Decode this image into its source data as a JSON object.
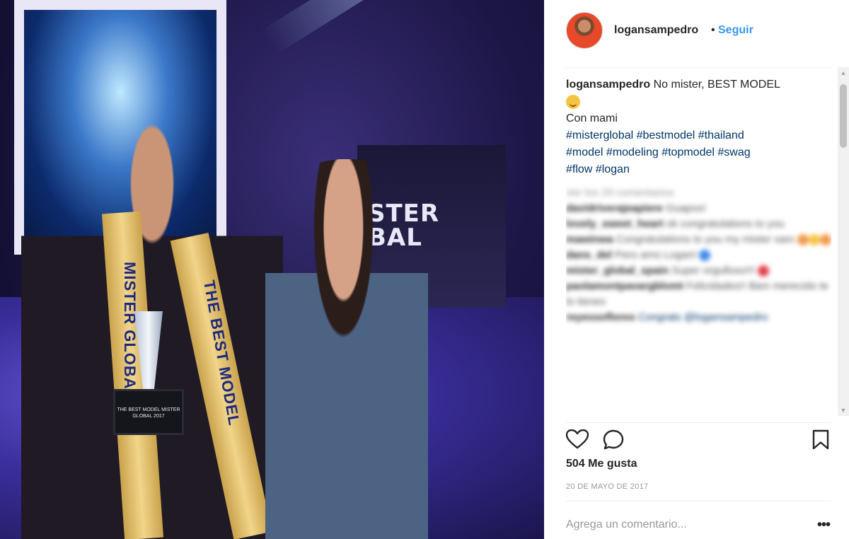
{
  "photo": {
    "banner_text": "STER\nBAL",
    "sash_left": "MISTER GLOBAL",
    "sash_right": "THE BEST MODEL",
    "trophy_text": "THE BEST MODEL MISTER GLOBAL 2017"
  },
  "header": {
    "username": "logansampedro",
    "separator": "•",
    "follow_label": "Seguir"
  },
  "caption": {
    "username": "logansampedro",
    "line1": "No mister, BEST MODEL",
    "line2": "Con mami",
    "hashtags_line1": "#misterglobal #bestmodel #thailand",
    "hashtags_line2": "#model #modeling #topmodel #swag",
    "hashtags_line3": "#flow #logan"
  },
  "blurred_comments": [
    {
      "user": "",
      "text": "Ver los 29 comentarios"
    },
    {
      "user": "davidriverajeapiere",
      "text": "Guapos!"
    },
    {
      "user": "lovely_sweet_heart",
      "text": "ok congratulations to you"
    },
    {
      "user": "mawinwa",
      "text": "Congratulations to you my mister sam"
    },
    {
      "user": "dans_del",
      "text": "Pero amo Logan!"
    },
    {
      "user": "mister_global_spain",
      "text": "Super orgulloso!!!"
    },
    {
      "user": "paolamontpavargblomt",
      "text": "Felicidades!! Bien merecido te lo tienes"
    },
    {
      "user": "reyessoflores",
      "text": "Congrats @logansampedro"
    }
  ],
  "actions": {
    "like_icon": "heart-icon",
    "comment_icon": "comment-icon",
    "save_icon": "bookmark-icon"
  },
  "likes": "504 Me gusta",
  "date": "20 DE MAYO DE 2017",
  "comment_box": {
    "placeholder": "Agrega un comentario...",
    "more_label": "•••"
  },
  "colors": {
    "accent": "#3897f0",
    "hashtag": "#003569",
    "text": "#262626",
    "muted": "#999999"
  }
}
